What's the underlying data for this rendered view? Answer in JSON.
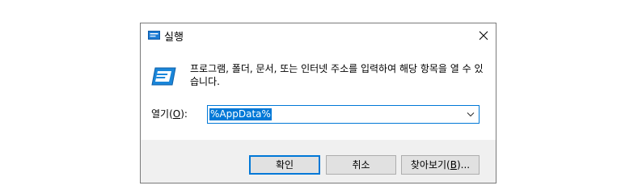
{
  "dialog": {
    "title": "실행",
    "title_icon": "run-icon",
    "close_icon": "close-icon"
  },
  "content": {
    "description": "프로그램, 폴더, 문서, 또는 인터넷 주소를 입력하여 해당 항목을 열 수 있습니다.",
    "open_label_prefix": "열기(",
    "open_label_accel": "O",
    "open_label_suffix": "):",
    "combo_value": "%AppData%",
    "combo_arrow_icon": "chevron-down-icon"
  },
  "buttons": {
    "ok_label": "확인",
    "cancel_label": "취소",
    "browse_prefix": "찾아보기(",
    "browse_accel": "B",
    "browse_suffix": ")..."
  },
  "colors": {
    "accent": "#0078d7",
    "dialog_bg": "#f0f0f0",
    "button_bg": "#e1e1e1"
  }
}
